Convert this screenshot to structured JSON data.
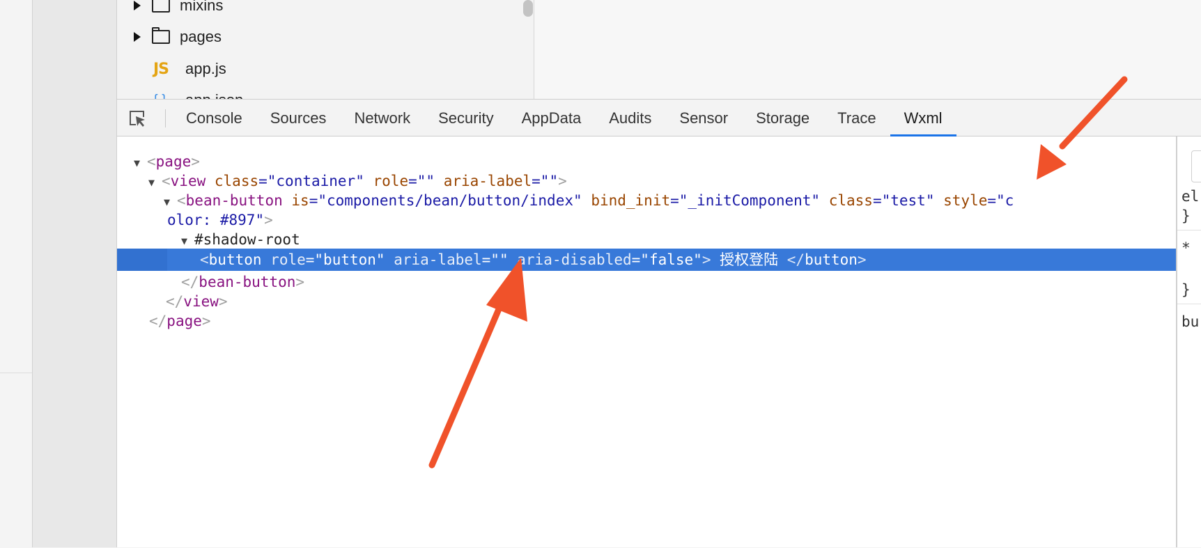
{
  "file_tree": {
    "items": [
      {
        "label": "mixins",
        "icon": "folder-icon",
        "expandable": true
      },
      {
        "label": "pages",
        "icon": "folder-icon",
        "expandable": true
      },
      {
        "label": "app.js",
        "icon": "js-file-icon",
        "icon_text": "JS",
        "expandable": false
      },
      {
        "label": "app.json",
        "icon": "json-file-icon",
        "icon_text": "{ }",
        "expandable": false
      }
    ]
  },
  "devtools": {
    "tabs": [
      "Console",
      "Sources",
      "Network",
      "Security",
      "AppData",
      "Audits",
      "Sensor",
      "Storage",
      "Trace",
      "Wxml"
    ],
    "active_tab": "Wxml",
    "accent_color": "#1a73e8"
  },
  "wxml": {
    "page_tag": "page",
    "view_tag": "view",
    "view_attrs": [
      {
        "name": "class",
        "value": "container"
      },
      {
        "name": "role",
        "value": ""
      },
      {
        "name": "aria-label",
        "value": ""
      }
    ],
    "bean_tag": "bean-button",
    "bean_attrs": [
      {
        "name": "is",
        "value": "components/bean/button/index"
      },
      {
        "name": "bind_init",
        "value": "_initComponent"
      },
      {
        "name": "class",
        "value": "test"
      }
    ],
    "bean_style_name": "style",
    "bean_style_value_part1": "c",
    "bean_style_value_part2": "olor: #897",
    "shadow_root": "#shadow-root",
    "button_tag": "button",
    "button_attrs": [
      {
        "name": "role",
        "value": "button"
      },
      {
        "name": "aria-label",
        "value": ""
      },
      {
        "name": "aria-disabled",
        "value": "false"
      }
    ],
    "button_text": " 授权登陆 ",
    "selected_color": "#3879d9"
  },
  "styles_pane": {
    "lines": [
      "el",
      "}",
      "*",
      "}",
      "bu"
    ]
  },
  "annotation_color": "#f0522a"
}
